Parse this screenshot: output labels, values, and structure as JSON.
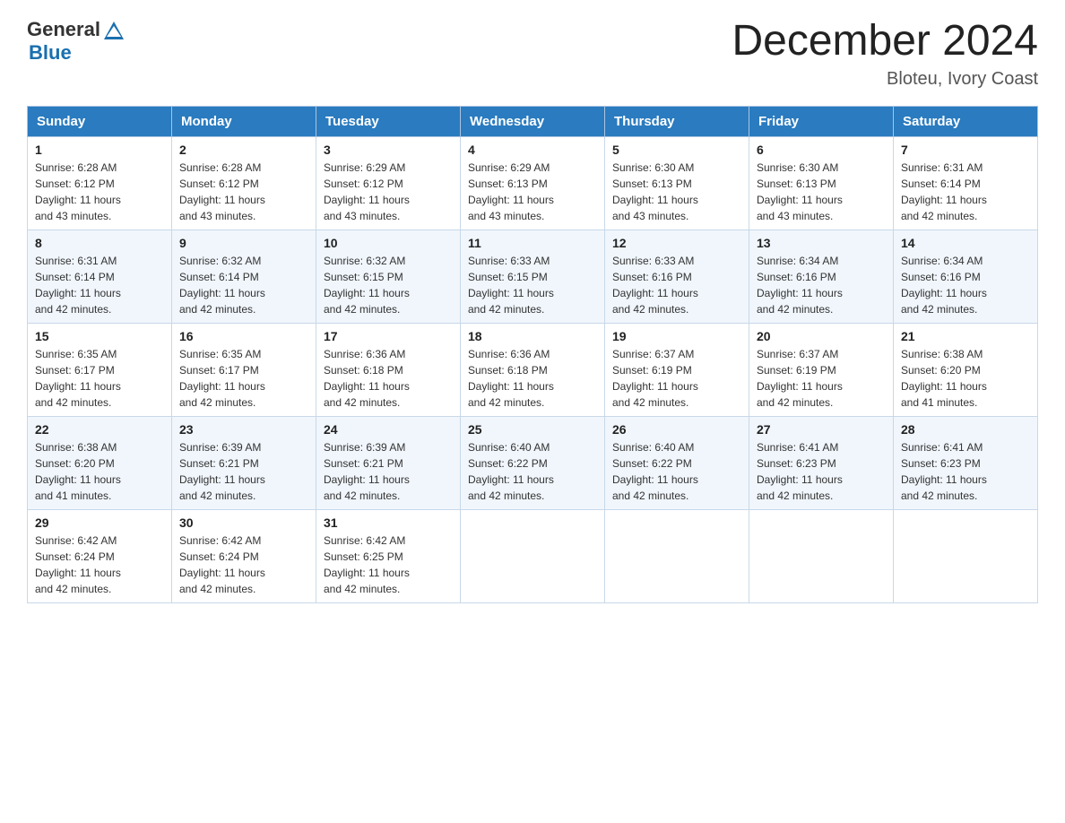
{
  "header": {
    "logo_general": "General",
    "logo_blue": "Blue",
    "main_title": "December 2024",
    "subtitle": "Bloteu, Ivory Coast"
  },
  "calendar": {
    "days_of_week": [
      "Sunday",
      "Monday",
      "Tuesday",
      "Wednesday",
      "Thursday",
      "Friday",
      "Saturday"
    ],
    "weeks": [
      [
        {
          "day": "1",
          "sunrise": "6:28 AM",
          "sunset": "6:12 PM",
          "daylight": "11 hours and 43 minutes."
        },
        {
          "day": "2",
          "sunrise": "6:28 AM",
          "sunset": "6:12 PM",
          "daylight": "11 hours and 43 minutes."
        },
        {
          "day": "3",
          "sunrise": "6:29 AM",
          "sunset": "6:12 PM",
          "daylight": "11 hours and 43 minutes."
        },
        {
          "day": "4",
          "sunrise": "6:29 AM",
          "sunset": "6:13 PM",
          "daylight": "11 hours and 43 minutes."
        },
        {
          "day": "5",
          "sunrise": "6:30 AM",
          "sunset": "6:13 PM",
          "daylight": "11 hours and 43 minutes."
        },
        {
          "day": "6",
          "sunrise": "6:30 AM",
          "sunset": "6:13 PM",
          "daylight": "11 hours and 43 minutes."
        },
        {
          "day": "7",
          "sunrise": "6:31 AM",
          "sunset": "6:14 PM",
          "daylight": "11 hours and 42 minutes."
        }
      ],
      [
        {
          "day": "8",
          "sunrise": "6:31 AM",
          "sunset": "6:14 PM",
          "daylight": "11 hours and 42 minutes."
        },
        {
          "day": "9",
          "sunrise": "6:32 AM",
          "sunset": "6:14 PM",
          "daylight": "11 hours and 42 minutes."
        },
        {
          "day": "10",
          "sunrise": "6:32 AM",
          "sunset": "6:15 PM",
          "daylight": "11 hours and 42 minutes."
        },
        {
          "day": "11",
          "sunrise": "6:33 AM",
          "sunset": "6:15 PM",
          "daylight": "11 hours and 42 minutes."
        },
        {
          "day": "12",
          "sunrise": "6:33 AM",
          "sunset": "6:16 PM",
          "daylight": "11 hours and 42 minutes."
        },
        {
          "day": "13",
          "sunrise": "6:34 AM",
          "sunset": "6:16 PM",
          "daylight": "11 hours and 42 minutes."
        },
        {
          "day": "14",
          "sunrise": "6:34 AM",
          "sunset": "6:16 PM",
          "daylight": "11 hours and 42 minutes."
        }
      ],
      [
        {
          "day": "15",
          "sunrise": "6:35 AM",
          "sunset": "6:17 PM",
          "daylight": "11 hours and 42 minutes."
        },
        {
          "day": "16",
          "sunrise": "6:35 AM",
          "sunset": "6:17 PM",
          "daylight": "11 hours and 42 minutes."
        },
        {
          "day": "17",
          "sunrise": "6:36 AM",
          "sunset": "6:18 PM",
          "daylight": "11 hours and 42 minutes."
        },
        {
          "day": "18",
          "sunrise": "6:36 AM",
          "sunset": "6:18 PM",
          "daylight": "11 hours and 42 minutes."
        },
        {
          "day": "19",
          "sunrise": "6:37 AM",
          "sunset": "6:19 PM",
          "daylight": "11 hours and 42 minutes."
        },
        {
          "day": "20",
          "sunrise": "6:37 AM",
          "sunset": "6:19 PM",
          "daylight": "11 hours and 42 minutes."
        },
        {
          "day": "21",
          "sunrise": "6:38 AM",
          "sunset": "6:20 PM",
          "daylight": "11 hours and 41 minutes."
        }
      ],
      [
        {
          "day": "22",
          "sunrise": "6:38 AM",
          "sunset": "6:20 PM",
          "daylight": "11 hours and 41 minutes."
        },
        {
          "day": "23",
          "sunrise": "6:39 AM",
          "sunset": "6:21 PM",
          "daylight": "11 hours and 42 minutes."
        },
        {
          "day": "24",
          "sunrise": "6:39 AM",
          "sunset": "6:21 PM",
          "daylight": "11 hours and 42 minutes."
        },
        {
          "day": "25",
          "sunrise": "6:40 AM",
          "sunset": "6:22 PM",
          "daylight": "11 hours and 42 minutes."
        },
        {
          "day": "26",
          "sunrise": "6:40 AM",
          "sunset": "6:22 PM",
          "daylight": "11 hours and 42 minutes."
        },
        {
          "day": "27",
          "sunrise": "6:41 AM",
          "sunset": "6:23 PM",
          "daylight": "11 hours and 42 minutes."
        },
        {
          "day": "28",
          "sunrise": "6:41 AM",
          "sunset": "6:23 PM",
          "daylight": "11 hours and 42 minutes."
        }
      ],
      [
        {
          "day": "29",
          "sunrise": "6:42 AM",
          "sunset": "6:24 PM",
          "daylight": "11 hours and 42 minutes."
        },
        {
          "day": "30",
          "sunrise": "6:42 AM",
          "sunset": "6:24 PM",
          "daylight": "11 hours and 42 minutes."
        },
        {
          "day": "31",
          "sunrise": "6:42 AM",
          "sunset": "6:25 PM",
          "daylight": "11 hours and 42 minutes."
        },
        null,
        null,
        null,
        null
      ]
    ],
    "labels": {
      "sunrise": "Sunrise:",
      "sunset": "Sunset:",
      "daylight": "Daylight:"
    }
  }
}
